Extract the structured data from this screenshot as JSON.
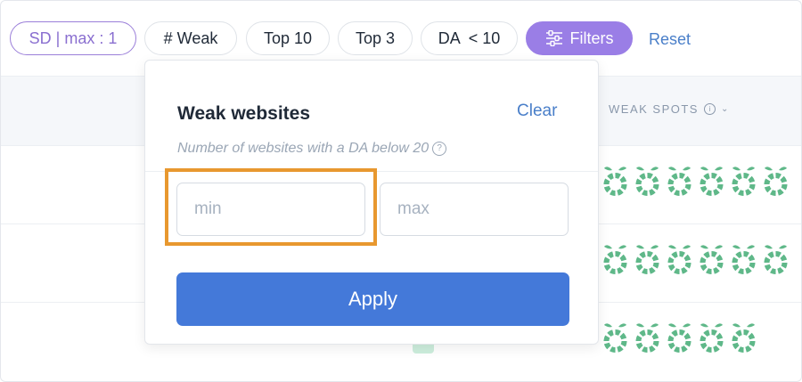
{
  "filter_bar": {
    "chips": [
      {
        "label": "SD | max : 1"
      },
      {
        "label": "# Weak"
      },
      {
        "label": "Top 10"
      },
      {
        "label": "Top 3"
      },
      {
        "label": "DA  < 10"
      }
    ],
    "filters_button": {
      "label": "Filters"
    },
    "reset_label": "Reset"
  },
  "table": {
    "weak_spots_header": "WEAK SPOTS",
    "info_glyph": "i",
    "chevron_glyph": "⌄",
    "rows": [
      {
        "weak_spot_count": 6
      },
      {
        "weak_spot_count": 6
      },
      {
        "weak_spot_count": 5
      }
    ],
    "spot_color": "#5fb889"
  },
  "popup": {
    "title": "Weak websites",
    "clear_label": "Clear",
    "subtitle": "Number of websites with a DA below 20",
    "help_glyph": "?",
    "min_placeholder": "min",
    "max_placeholder": "max",
    "apply_label": "Apply",
    "highlight_color": "#e8982f"
  },
  "colors": {
    "accent_purple": "#9a7ee6",
    "link_blue": "#4a7fc9",
    "apply_blue": "#4479d9"
  }
}
